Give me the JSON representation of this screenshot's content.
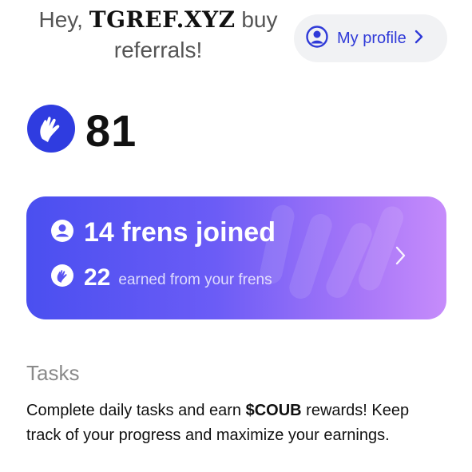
{
  "header": {
    "greeting_prefix": "Hey, ",
    "username": "TGREF.XYZ",
    "greeting_suffix": " buy referrals!"
  },
  "profile_button": {
    "label": "My profile",
    "icon": "user-circle-icon",
    "chevron": "chevron-right-icon"
  },
  "balance": {
    "icon": "coub-hand-icon",
    "value": "81"
  },
  "referrals": {
    "joined_count_text": "14 frens joined",
    "earned_value": "22",
    "earned_text": "earned from your frens",
    "accent_from": "#4a4ff0",
    "accent_to": "#c68cfb"
  },
  "tasks": {
    "title": "Tasks",
    "desc_part1": "Complete daily tasks and earn ",
    "desc_token": "$COUB",
    "desc_part2": " rewards! Keep track of your progress and maximize your earnings."
  },
  "colors": {
    "brand_blue": "#2f3ad8",
    "pill_bg": "#f1f2f4",
    "coin_blue": "#2f3ce0"
  }
}
